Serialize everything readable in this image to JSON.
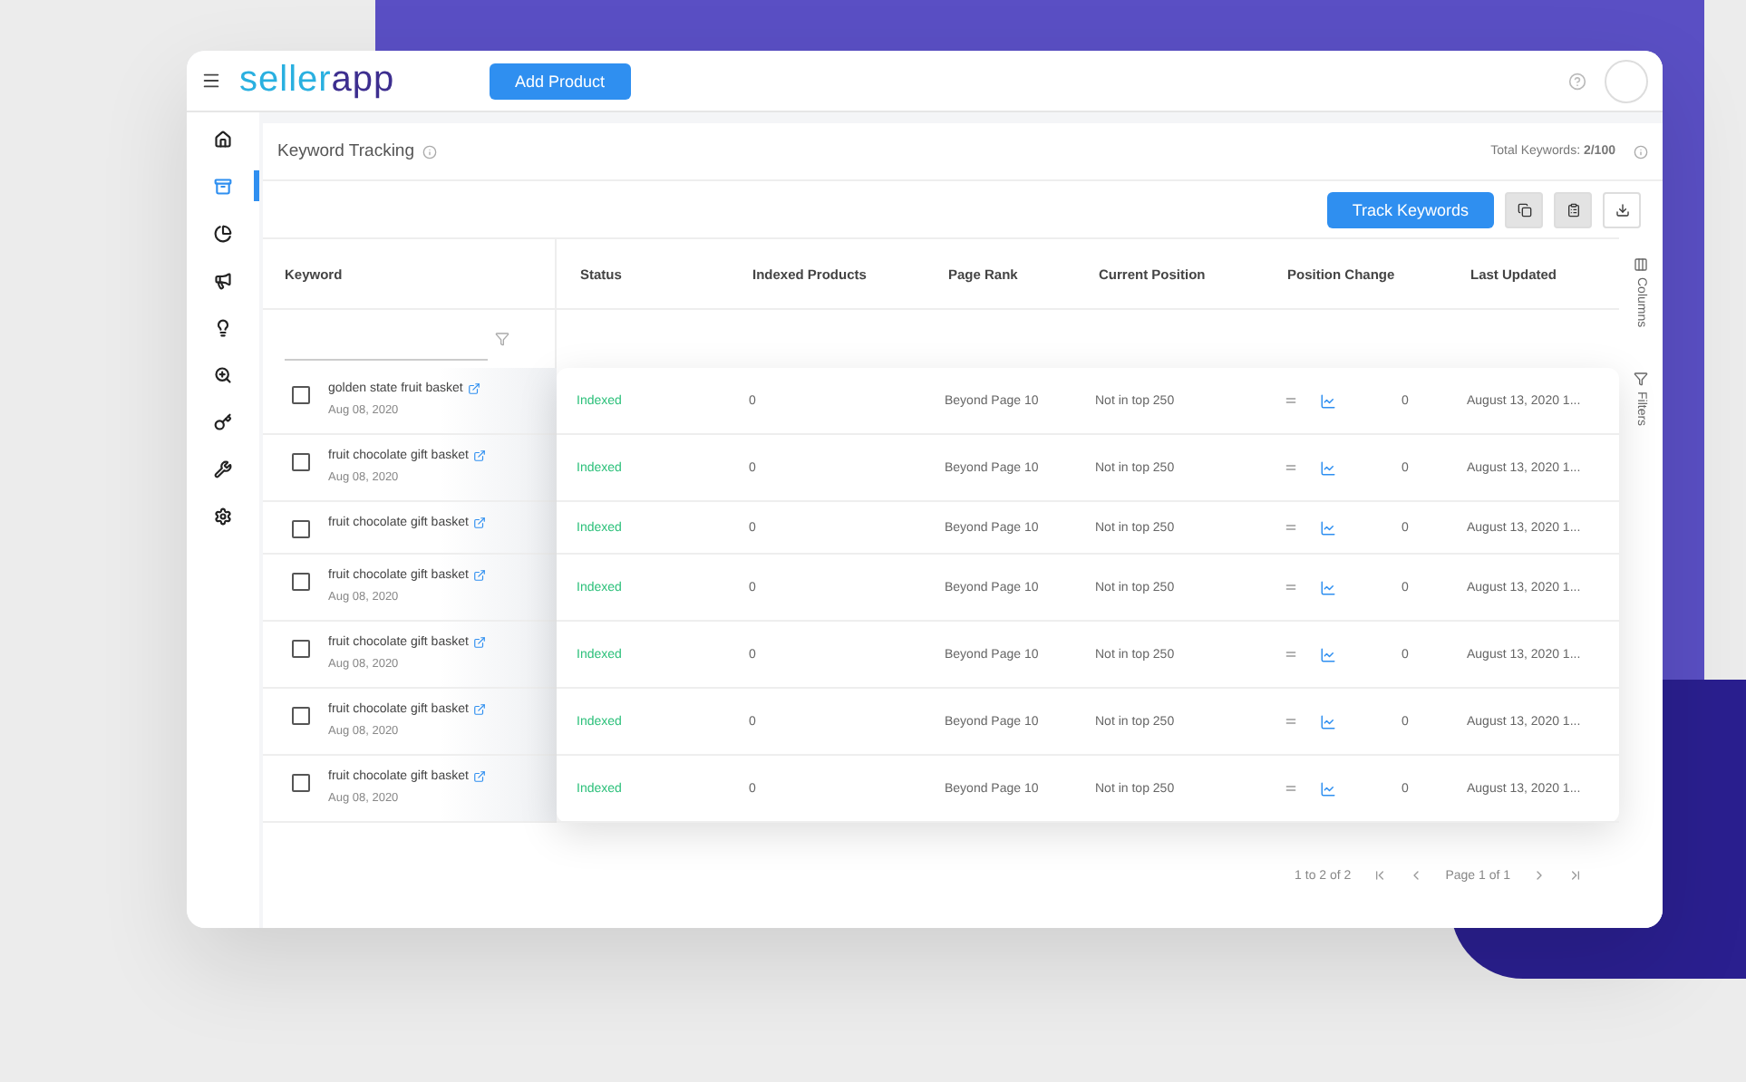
{
  "header": {
    "logo": [
      "seller",
      "app"
    ],
    "add_button": "Add Product"
  },
  "sidebar": {
    "items": [
      {
        "selected": false
      },
      {
        "selected": true
      },
      {
        "selected": false
      },
      {
        "selected": false
      },
      {
        "selected": false
      },
      {
        "selected": false
      },
      {
        "selected": false
      },
      {
        "selected": false
      },
      {
        "selected": false
      }
    ]
  },
  "page": {
    "title": "Keyword Tracking",
    "total": "Total Keywords: **2/100**",
    "track_button": "Track Keywords"
  },
  "table": {
    "columns": [
      "Keyword",
      "Status",
      "Indexed Products",
      "Page Rank",
      "Current Position",
      "Position Change",
      "Last Updated"
    ],
    "rows": [
      {
        "keyword": "golden state fruit basket",
        "date": "Aug 08, 2020",
        "checked": false,
        "status": "Indexed",
        "indexed": "0",
        "page_rank": "Beyond Page 10",
        "position": "Not in top 250",
        "change": "0",
        "updated": "August 13, 2020 1..."
      },
      {
        "keyword": "fruit chocolate gift basket",
        "date": "Aug 08, 2020",
        "checked": false,
        "status": "Indexed",
        "indexed": "0",
        "page_rank": "Beyond Page 10",
        "position": "Not in top 250",
        "change": "0",
        "updated": "August 13, 2020 1..."
      },
      {
        "keyword": "fruit chocolate gift basket",
        "checked": false,
        "status": "Indexed",
        "indexed": "0",
        "page_rank": "Beyond Page 10",
        "position": "Not in top 250",
        "change": "0",
        "updated": "August 13, 2020 1..."
      },
      {
        "keyword": "fruit chocolate gift basket",
        "date": "Aug 08, 2020",
        "checked": false,
        "status": "Indexed",
        "indexed": "0",
        "page_rank": "Beyond Page 10",
        "position": "Not in top 250",
        "change": "0",
        "updated": "August 13, 2020 1..."
      },
      {
        "keyword": "fruit chocolate gift basket",
        "date": "Aug 08, 2020",
        "checked": false,
        "status": "Indexed",
        "indexed": "0",
        "page_rank": "Beyond Page 10",
        "position": "Not in top 250",
        "change": "0",
        "updated": "August 13, 2020 1..."
      },
      {
        "keyword": "fruit chocolate gift basket",
        "date": "Aug 08, 2020",
        "checked": false,
        "status": "Indexed",
        "indexed": "0",
        "page_rank": "Beyond Page 10",
        "position": "Not in top 250",
        "change": "0",
        "updated": "August 13, 2020 1..."
      },
      {
        "keyword": "fruit chocolate gift basket",
        "date": "Aug 08, 2020",
        "checked": false,
        "status": "Indexed",
        "indexed": "0",
        "page_rank": "Beyond Page 10",
        "position": "Not in top 250",
        "change": "0",
        "updated": "August 13, 2020 1..."
      }
    ]
  },
  "side_panel": [
    "Columns",
    "Filters"
  ],
  "pagination": {
    "range": "1 to 2 of 2",
    "page": "Page 1 of 1"
  }
}
